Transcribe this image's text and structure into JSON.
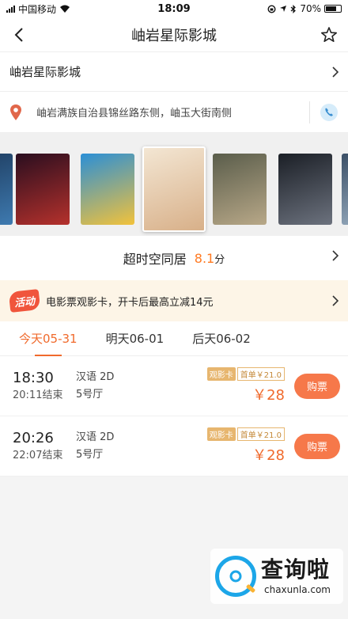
{
  "status_bar": {
    "carrier": "中国移动",
    "time": "18:09",
    "battery": "70%",
    "battery_level": 0.7
  },
  "nav": {
    "title": "岫岩星际影城",
    "back_icon": "chevron-left-icon",
    "favorite_icon": "star-outline-icon"
  },
  "cinema": {
    "name": "岫岩星际影城",
    "address": "岫岩满族自治县锦丝路东侧，岫玉大街南侧",
    "location_icon": "map-pin-icon",
    "phone_icon": "phone-icon"
  },
  "posters": {
    "items": [
      {
        "name": "poster-1",
        "colors": [
          "#1d3a5c",
          "#3e7ab0"
        ]
      },
      {
        "name": "poster-2",
        "colors": [
          "#2a0e1f",
          "#b5312c"
        ]
      },
      {
        "name": "poster-3",
        "colors": [
          "#2b8fd6",
          "#f2c23b"
        ]
      },
      {
        "name": "poster-4",
        "colors": [
          "#f3e6d3",
          "#d8b089"
        ]
      },
      {
        "name": "poster-5",
        "colors": [
          "#5a5d4b",
          "#b8a888"
        ]
      },
      {
        "name": "poster-6",
        "colors": [
          "#1b1f26",
          "#6c727e"
        ]
      },
      {
        "name": "poster-7",
        "colors": [
          "#3b4f66",
          "#9fb3c6"
        ]
      }
    ],
    "active_index": 3
  },
  "movie": {
    "title": "超时空同居",
    "score": "8.1",
    "score_unit": "分"
  },
  "promo": {
    "badge": "活动",
    "text": "电影票观影卡，开卡后最高立减14元"
  },
  "dates": [
    {
      "label": "今天05-31",
      "active": true
    },
    {
      "label": "明天06-01",
      "active": false
    },
    {
      "label": "后天06-02",
      "active": false
    }
  ],
  "showtimes": [
    {
      "start": "18:30",
      "end": "20:11结束",
      "lang": "汉语 2D",
      "hall": "5号厅",
      "tag_card": "观影卡",
      "tag_first": "首单￥21.0",
      "price": "￥28",
      "buy": "购票"
    },
    {
      "start": "20:26",
      "end": "22:07结束",
      "lang": "汉语 2D",
      "hall": "5号厅",
      "tag_card": "观影卡",
      "tag_first": "首单￥21.0",
      "price": "￥28",
      "buy": "购票"
    }
  ],
  "watermark": {
    "cn": "查询啦",
    "en": "chaxunla.com"
  },
  "colors": {
    "accent": "#f06a2c",
    "buy_button": "#f6784a",
    "promo_bg": "#fdf5e7",
    "score": "#ff7a22"
  }
}
